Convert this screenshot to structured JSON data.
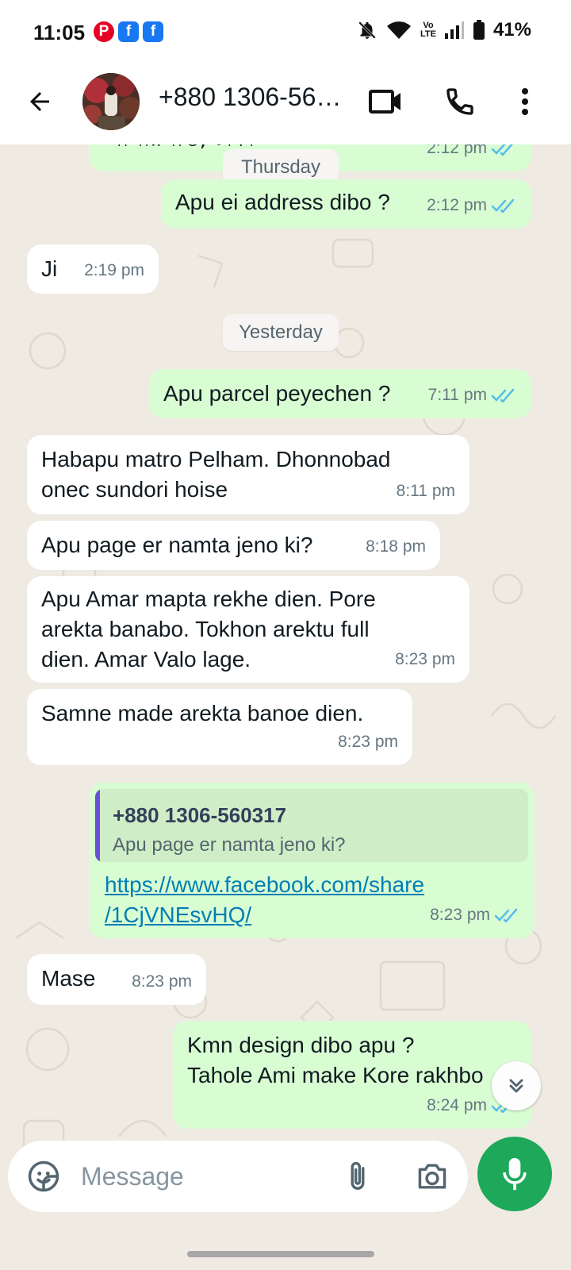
{
  "status_bar": {
    "time": "11:05",
    "notification_icons": [
      "pinterest-icon",
      "facebook-icon",
      "facebook-icon"
    ],
    "volte_line1": "Vo",
    "volte_line2": "LTE",
    "battery": "41%"
  },
  "header": {
    "contact": "+880 1306-56…"
  },
  "date_chips": {
    "thursday": "Thursday",
    "yesterday": "Yesterday"
  },
  "messages": [
    {
      "dir": "out",
      "text": "আগারগাও, ঢাকা",
      "time": "2:12 pm",
      "read": true
    },
    {
      "dir": "out",
      "text": "Apu ei address dibo ?",
      "time": "2:12 pm",
      "read": true
    },
    {
      "dir": "in",
      "text": "Ji",
      "time": "2:19 pm"
    },
    {
      "dir": "out",
      "text": "Apu parcel peyechen ?",
      "time": "7:11 pm",
      "read": true
    },
    {
      "dir": "in",
      "text": "Habapu matro Pelham. Dhonnobad\nonec sundori hoise",
      "time": "8:11 pm"
    },
    {
      "dir": "in",
      "text": "Apu page er namta jeno ki?",
      "time": "8:18 pm"
    },
    {
      "dir": "in",
      "text": "Apu Amar mapta rekhe dien. Pore\narekta banabo. Tokhon arektu full\ndien. Amar Valo lage.",
      "time": "8:23 pm"
    },
    {
      "dir": "in",
      "text": "Samne made arekta banoe dien.",
      "time": "8:23 pm"
    },
    {
      "dir": "out",
      "quote_name": "+880 1306-560317",
      "quote_text": "Apu page er namta jeno ki?",
      "link": "https://www.facebook.com/share\n/1CjVNEsvHQ/",
      "time": "8:23 pm",
      "read": true
    },
    {
      "dir": "in",
      "text": "Mase",
      "time": "8:23 pm"
    },
    {
      "dir": "out",
      "text": "Kmn design dibo apu ?\nTahole Ami make Kore rakhbo",
      "time": "8:24 pm",
      "read": true
    }
  ],
  "composer": {
    "placeholder": "Message"
  },
  "colors": {
    "outgoing_bubble": "#d9fdd3",
    "incoming_bubble": "#ffffff",
    "chat_background": "#efeae2",
    "read_ticks": "#53bdeb",
    "mic_button": "#1da85a",
    "quote_accent": "#6b4fd6"
  }
}
